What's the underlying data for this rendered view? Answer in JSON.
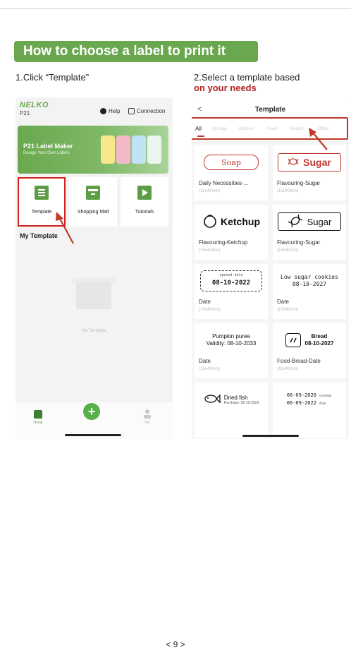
{
  "banner": {
    "title": "How to choose a label to print it"
  },
  "steps": {
    "step1": "1.Click “Template”",
    "step2_line1": "2.Select a template based",
    "step2_line2": "on your needs"
  },
  "left_phone": {
    "brand": "NELKO",
    "model": "P21",
    "help_label": "Help",
    "connection_label": "Connection",
    "hero_title": "P21 Label Maker",
    "hero_subtitle": "Design Your Own Labels",
    "menu": [
      {
        "label": "Template",
        "icon": "template-icon"
      },
      {
        "label": "Shopping Mall",
        "icon": "shopping-mall-icon"
      },
      {
        "label": "Tutorials",
        "icon": "tutorials-icon"
      }
    ],
    "my_template_heading": "My Template",
    "empty_text": "No Template",
    "nav": {
      "home_label": "Home",
      "add_symbol": "+",
      "me_label": "Me"
    }
  },
  "right_phone": {
    "back_symbol": "<",
    "title": "Template",
    "tabs": [
      "All",
      "Storage",
      "Kitchen",
      "Food",
      "Electric",
      "Office"
    ],
    "templates": [
      {
        "preview": "Soap",
        "name": "Daily Necessities-...",
        "size": "(15x40mm)"
      },
      {
        "preview": "Sugar",
        "name": "Flavouring-Sugar",
        "size": "(15x40mm)"
      },
      {
        "preview": "Ketchup",
        "name": "Flavouring-Ketchup",
        "size": "(15x40mm)"
      },
      {
        "preview": "Sugar",
        "name": "Flavouring-Sugar",
        "size": "(15x40mm)"
      },
      {
        "preview_small": "opened date",
        "preview": "08-10-2022",
        "name": "Date",
        "size": "(15x40mm)"
      },
      {
        "preview_line1": "Low sugar cookies",
        "preview_line2": "08-10-2027",
        "name": "Date",
        "size": "(15x40mm)"
      },
      {
        "preview_line1": "Pumpkin puree",
        "preview_line2": "Validity: 08-10-2033",
        "name": "Date",
        "size": "(15x40mm)"
      },
      {
        "preview_line1": "Bread",
        "preview_line2": "08-10-2027",
        "name": "Food-Bread-Date",
        "size": "(15x40mm)"
      },
      {
        "preview": "Dried fish",
        "preview_small": "Purchase: 08-10-2029",
        "name": "",
        "size": ""
      },
      {
        "preview_line1": "06-09-2020",
        "preview_tag1": "unseal",
        "preview_line2": "06-09-2022",
        "preview_tag2": "due",
        "name": "",
        "size": ""
      }
    ]
  },
  "page_number": "< 9 >",
  "colors": {
    "accent_green": "#6aa84f",
    "highlight_red": "#c0392b"
  }
}
